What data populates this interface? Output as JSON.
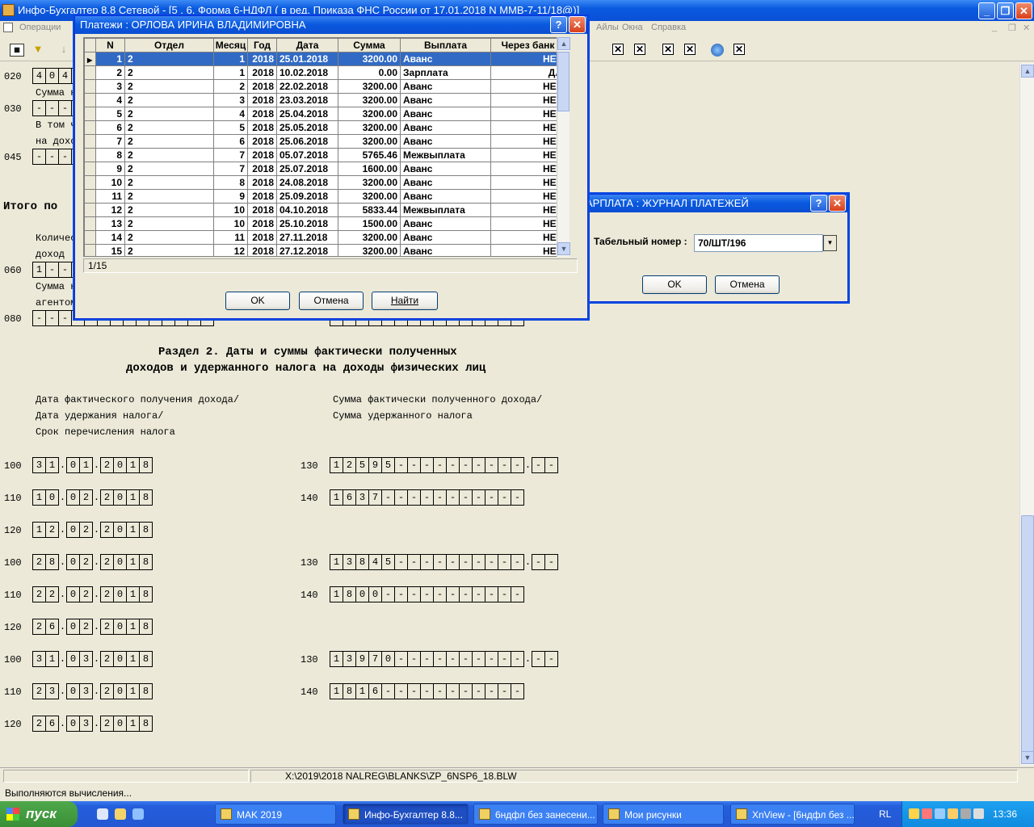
{
  "window": {
    "title": "Инфо-Бухгалтер 8.8 Сетевой - [5 . 6. Форма 6-НДФЛ ( в ред. Приказа ФНС России от 17.01.2018 N ММВ-7-11/18@)]"
  },
  "menu": {
    "items": [
      "Операции",
      "Айлы",
      "Окна",
      "Справка"
    ]
  },
  "document": {
    "rows_top": [
      {
        "code": "020",
        "digits": [
          "4",
          "0",
          "4"
        ]
      },
      {
        "code": "030",
        "digits": [
          "-",
          "-",
          "-"
        ]
      },
      {
        "code": "045",
        "digits": [
          "-",
          "-",
          "-"
        ]
      },
      {
        "code": "060",
        "digits": [
          "1",
          "-",
          "-"
        ]
      },
      {
        "code": "080",
        "digits": [
          "-",
          "-",
          "-"
        ]
      }
    ],
    "partial_texts": [
      "Сумма н",
      "В том ч",
      "на дохо",
      "Итого по",
      "Количес",
      "доход",
      "Сумма н",
      "агентом"
    ],
    "section_title_1": "Раздел 2. Даты и суммы фактически полученных",
    "section_title_2": "доходов и удержанного налога на доходы физических лиц",
    "left_labels": [
      "Дата фактического получения дохода/",
      "Дата удержания налога/",
      "Срок перечисления налога"
    ],
    "right_labels": [
      "Сумма фактически полученного дохода/",
      "Сумма удержанного налога"
    ],
    "date_rows": [
      {
        "code": "100",
        "date": "31.01.2018",
        "rcode": "130",
        "amount": "12595",
        "kop": true
      },
      {
        "code": "110",
        "date": "10.02.2018",
        "rcode": "140",
        "amount": "1637",
        "kop": false
      },
      {
        "code": "120",
        "date": "12.02.2018"
      },
      {
        "code": "100",
        "date": "28.02.2018",
        "rcode": "130",
        "amount": "13845",
        "kop": true
      },
      {
        "code": "110",
        "date": "22.02.2018",
        "rcode": "140",
        "amount": "1800",
        "kop": false
      },
      {
        "code": "120",
        "date": "26.02.2018"
      },
      {
        "code": "100",
        "date": "31.03.2018",
        "rcode": "130",
        "amount": "13970",
        "kop": true
      },
      {
        "code": "110",
        "date": "23.03.2018",
        "rcode": "140",
        "amount": "1816",
        "kop": false
      },
      {
        "code": "120",
        "date": "26.03.2018"
      }
    ]
  },
  "payments_dialog": {
    "title": "Платежи :  ОРЛОВА ИРИНА ВЛАДИМИРОВНА",
    "columns": [
      "N",
      "Отдел",
      "Месяц",
      "Год",
      "Дата",
      "Сумма",
      "Выплата",
      "Через банк"
    ],
    "rows": [
      [
        "1",
        "2",
        "1",
        "2018",
        "25.01.2018",
        "3200.00",
        "Аванс",
        "НЕТ"
      ],
      [
        "2",
        "2",
        "1",
        "2018",
        "10.02.2018",
        "0.00",
        "Зарплата",
        "ДА"
      ],
      [
        "3",
        "2",
        "2",
        "2018",
        "22.02.2018",
        "3200.00",
        "Аванс",
        "НЕТ"
      ],
      [
        "4",
        "2",
        "3",
        "2018",
        "23.03.2018",
        "3200.00",
        "Аванс",
        "НЕТ"
      ],
      [
        "5",
        "2",
        "4",
        "2018",
        "25.04.2018",
        "3200.00",
        "Аванс",
        "НЕТ"
      ],
      [
        "6",
        "2",
        "5",
        "2018",
        "25.05.2018",
        "3200.00",
        "Аванс",
        "НЕТ"
      ],
      [
        "7",
        "2",
        "6",
        "2018",
        "25.06.2018",
        "3200.00",
        "Аванс",
        "НЕТ"
      ],
      [
        "8",
        "2",
        "7",
        "2018",
        "05.07.2018",
        "5765.46",
        "Межвыплата",
        "НЕТ"
      ],
      [
        "9",
        "2",
        "7",
        "2018",
        "25.07.2018",
        "1600.00",
        "Аванс",
        "НЕТ"
      ],
      [
        "10",
        "2",
        "8",
        "2018",
        "24.08.2018",
        "3200.00",
        "Аванс",
        "НЕТ"
      ],
      [
        "11",
        "2",
        "9",
        "2018",
        "25.09.2018",
        "3200.00",
        "Аванс",
        "НЕТ"
      ],
      [
        "12",
        "2",
        "10",
        "2018",
        "04.10.2018",
        "5833.44",
        "Межвыплата",
        "НЕТ"
      ],
      [
        "13",
        "2",
        "10",
        "2018",
        "25.10.2018",
        "1500.00",
        "Аванс",
        "НЕТ"
      ],
      [
        "14",
        "2",
        "11",
        "2018",
        "27.11.2018",
        "3200.00",
        "Аванс",
        "НЕТ"
      ],
      [
        "15",
        "2",
        "12",
        "2018",
        "27.12.2018",
        "3200.00",
        "Аванс",
        "НЕТ"
      ]
    ],
    "selected_row": 0,
    "record_counter": "1/15",
    "ok": "OK",
    "cancel": "Отмена",
    "find": "Найти"
  },
  "journal_dialog": {
    "title": "АРПЛАТА : ЖУРНАЛ ПЛАТЕЖЕЙ",
    "tab_label": "Табельный номер :",
    "tab_value": "70/ШТ/196",
    "ok": "OK",
    "cancel": "Отмена"
  },
  "pathbar": {
    "path": "X:\\2019\\2018 NALREG\\BLANKS\\ZP_6NSP6_18.BLW"
  },
  "status": {
    "text": "Выполняются вычисления..."
  },
  "taskbar": {
    "start": "пуск",
    "tasks": [
      "MAK 2019",
      "Инфо-Бухгалтер 8.8...",
      "6ндфл без занесени...",
      "Мои рисунки",
      "XnView - [6ндфл без ..."
    ],
    "lang": "RL",
    "clock": "13:36"
  }
}
